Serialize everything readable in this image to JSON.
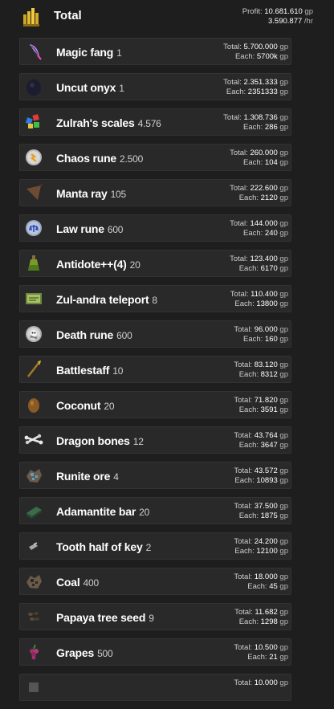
{
  "header": {
    "title": "Total",
    "profit_label": "Profit:",
    "profit_value": "10.681.610",
    "profit_unit": "gp",
    "rate_value": "3.590.877",
    "rate_unit": "/hr",
    "icon": "coins-icon"
  },
  "total_label": "Total:",
  "each_label": "Each:",
  "unit_gp": "gp",
  "items": [
    {
      "name": "Magic fang",
      "qty": "1",
      "total": "5.700.000",
      "each": "5700k",
      "icon": "magic-fang-icon"
    },
    {
      "name": "Uncut onyx",
      "qty": "1",
      "total": "2.351.333",
      "each": "2351333",
      "icon": "uncut-onyx-icon"
    },
    {
      "name": "Zulrah's scales",
      "qty": "4.576",
      "total": "1.308.736",
      "each": "286",
      "icon": "zulrahs-scales-icon"
    },
    {
      "name": "Chaos rune",
      "qty": "2.500",
      "total": "260.000",
      "each": "104",
      "icon": "chaos-rune-icon"
    },
    {
      "name": "Manta ray",
      "qty": "105",
      "total": "222.600",
      "each": "2120",
      "icon": "manta-ray-icon"
    },
    {
      "name": "Law rune",
      "qty": "600",
      "total": "144.000",
      "each": "240",
      "icon": "law-rune-icon"
    },
    {
      "name": "Antidote++(4)",
      "qty": "20",
      "total": "123.400",
      "each": "6170",
      "icon": "antidote-icon"
    },
    {
      "name": "Zul-andra teleport",
      "qty": "8",
      "total": "110.400",
      "each": "13800",
      "icon": "teleport-scroll-icon"
    },
    {
      "name": "Death rune",
      "qty": "600",
      "total": "96.000",
      "each": "160",
      "icon": "death-rune-icon"
    },
    {
      "name": "Battlestaff",
      "qty": "10",
      "total": "83.120",
      "each": "8312",
      "icon": "battlestaff-icon"
    },
    {
      "name": "Coconut",
      "qty": "20",
      "total": "71.820",
      "each": "3591",
      "icon": "coconut-icon"
    },
    {
      "name": "Dragon bones",
      "qty": "12",
      "total": "43.764",
      "each": "3647",
      "icon": "dragon-bones-icon"
    },
    {
      "name": "Runite ore",
      "qty": "4",
      "total": "43.572",
      "each": "10893",
      "icon": "runite-ore-icon"
    },
    {
      "name": "Adamantite bar",
      "qty": "20",
      "total": "37.500",
      "each": "1875",
      "icon": "adamantite-bar-icon"
    },
    {
      "name": "Tooth half of key",
      "qty": "2",
      "total": "24.200",
      "each": "12100",
      "icon": "key-half-icon"
    },
    {
      "name": "Coal",
      "qty": "400",
      "total": "18.000",
      "each": "45",
      "icon": "coal-icon"
    },
    {
      "name": "Papaya tree seed",
      "qty": "9",
      "total": "11.682",
      "each": "1298",
      "icon": "seed-icon"
    },
    {
      "name": "Grapes",
      "qty": "500",
      "total": "10.500",
      "each": "21",
      "icon": "grapes-icon"
    },
    {
      "name": "",
      "qty": "",
      "total": "10.000",
      "each": "",
      "icon": "item-icon"
    }
  ]
}
